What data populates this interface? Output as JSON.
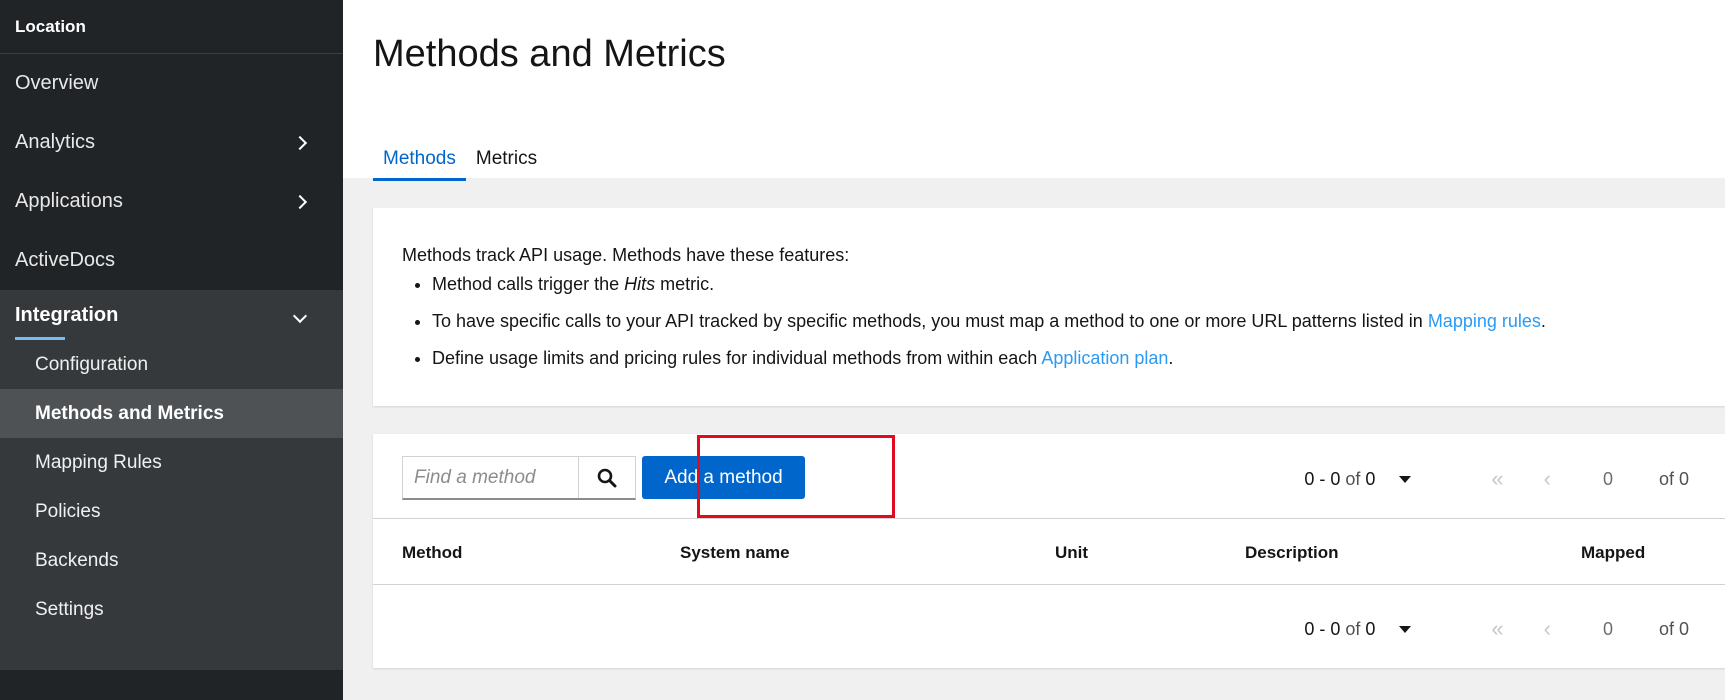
{
  "sidebar": {
    "location": "Location",
    "items": [
      {
        "label": "Overview"
      },
      {
        "label": "Analytics"
      },
      {
        "label": "Applications"
      },
      {
        "label": "ActiveDocs"
      }
    ],
    "group": {
      "label": "Integration",
      "subitems": [
        {
          "label": "Configuration"
        },
        {
          "label": "Methods and Metrics"
        },
        {
          "label": "Mapping Rules"
        },
        {
          "label": "Policies"
        },
        {
          "label": "Backends"
        },
        {
          "label": "Settings"
        }
      ]
    }
  },
  "page": {
    "title": "Methods and Metrics",
    "tabs": [
      {
        "label": "Methods"
      },
      {
        "label": "Metrics"
      }
    ]
  },
  "info": {
    "intro": "Methods track API usage. Methods have these features:",
    "bullet1_pre": "Method calls trigger the ",
    "bullet1_em": "Hits",
    "bullet1_post": " metric.",
    "bullet2_pre": "To have specific calls to your API tracked by specific methods, you must map a method to one or more URL patterns listed in ",
    "bullet2_link": "Mapping rules",
    "bullet2_post": ".",
    "bullet3_pre": "Define usage limits and pricing rules for individual methods from within each ",
    "bullet3_link": "Application plan",
    "bullet3_post": "."
  },
  "toolbar": {
    "search_placeholder": "Find a method",
    "add_label": "Add a method"
  },
  "pagination": {
    "range_start": "0",
    "range_sep": " - ",
    "range_end": "0",
    "of_word": " of ",
    "total": "0",
    "page": "0",
    "of_pages": "of 0"
  },
  "table": {
    "columns": [
      "Method",
      "System name",
      "Unit",
      "Description",
      "Mapped"
    ]
  },
  "colors": {
    "accent": "#0066cc",
    "highlight": "#e00b1e",
    "sidebar_bg": "#212427"
  }
}
